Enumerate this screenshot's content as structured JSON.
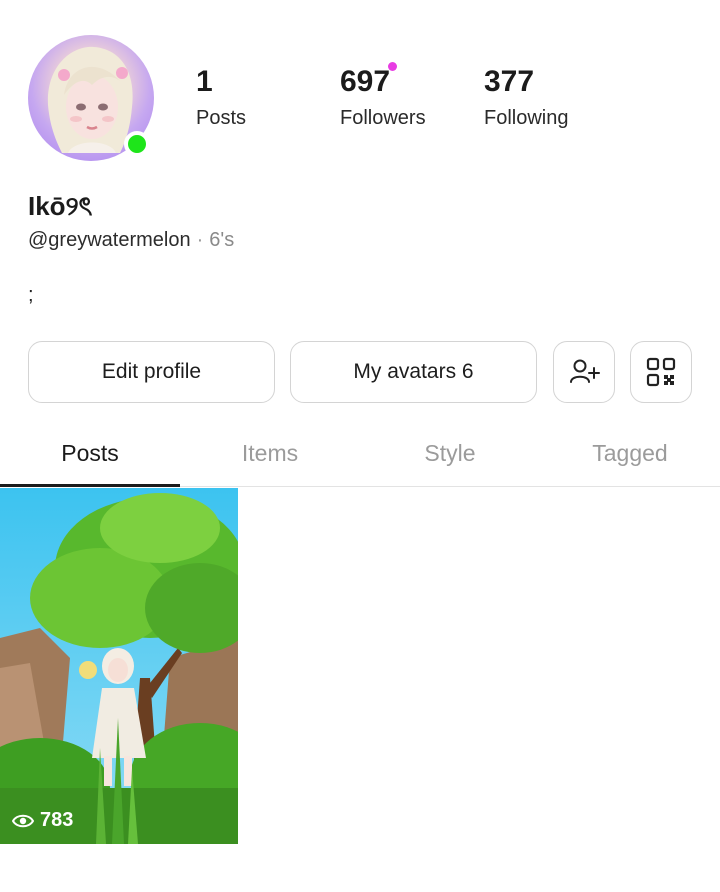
{
  "profile": {
    "display_name": "Ikō୨ৎ",
    "handle": "@greywatermelon",
    "zodiac": "6's",
    "bio": ";",
    "online_color": "#1ee51a"
  },
  "stats": {
    "posts": {
      "value": "1",
      "label": "Posts"
    },
    "followers": {
      "value": "697",
      "label": "Followers"
    },
    "following": {
      "value": "377",
      "label": "Following"
    }
  },
  "actions": {
    "edit_profile": "Edit profile",
    "my_avatars": "My avatars 6",
    "add_friend_icon": "add-person-icon",
    "qr_icon": "qr-code-icon"
  },
  "tabs": [
    {
      "label": "Posts",
      "active": true
    },
    {
      "label": "Items",
      "active": false
    },
    {
      "label": "Style",
      "active": false
    },
    {
      "label": "Tagged",
      "active": false
    }
  ],
  "posts": [
    {
      "views": "783",
      "icon": "eye-icon"
    }
  ],
  "colors": {
    "notification_dot": "#e83ce3",
    "active_tab": "#1b1b1b",
    "inactive_tab": "#9b9b9b"
  }
}
